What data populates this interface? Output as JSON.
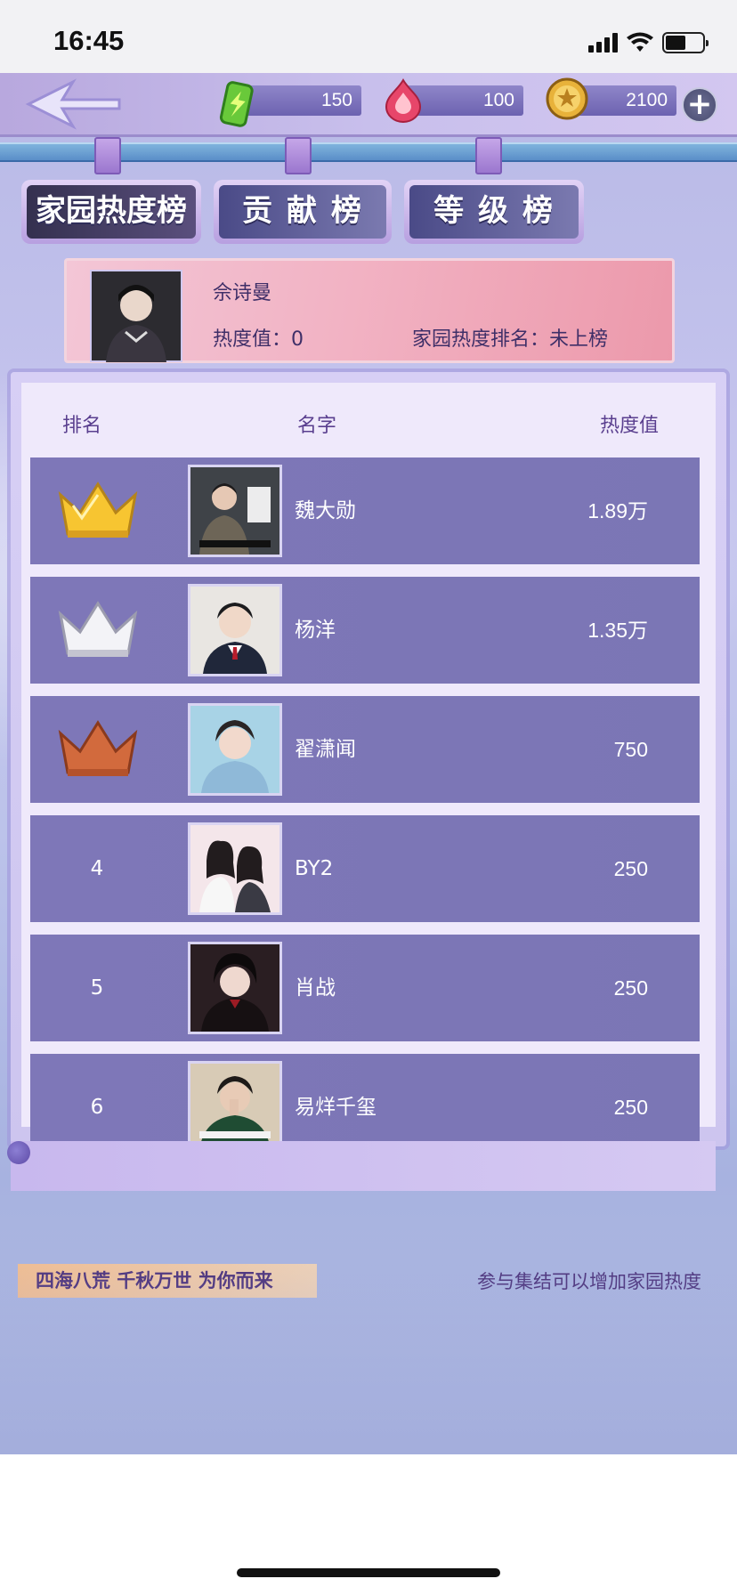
{
  "status_bar": {
    "time": "16:45"
  },
  "resources": {
    "energy": "150",
    "heart": "100",
    "coins": "2100"
  },
  "tabs": [
    {
      "label": "家园热度榜",
      "active": true
    },
    {
      "label": "贡 献 榜",
      "active": false
    },
    {
      "label": "等 级 榜",
      "active": false
    }
  ],
  "my_info": {
    "name": "佘诗曼",
    "heat": "热度值：0",
    "rank": "家园热度排名：未上榜"
  },
  "columns": {
    "rank": "排名",
    "name": "名字",
    "heat": "热度值"
  },
  "rows": [
    {
      "rank": "",
      "crown": "gold",
      "name": "魏大勋",
      "value": "1.89万"
    },
    {
      "rank": "",
      "crown": "silver",
      "name": "杨洋",
      "value": "1.35万"
    },
    {
      "rank": "",
      "crown": "bronze",
      "name": "翟潇闻",
      "value": "750"
    },
    {
      "rank": "4",
      "crown": "",
      "name": "BY2",
      "value": "250"
    },
    {
      "rank": "5",
      "crown": "",
      "name": "肖战",
      "value": "250"
    },
    {
      "rank": "6",
      "crown": "",
      "name": "易烊千玺",
      "value": "250"
    }
  ],
  "footer": {
    "slogan": "四海八荒 千秋万世 为你而来",
    "hint": "参与集结可以增加家园热度"
  }
}
